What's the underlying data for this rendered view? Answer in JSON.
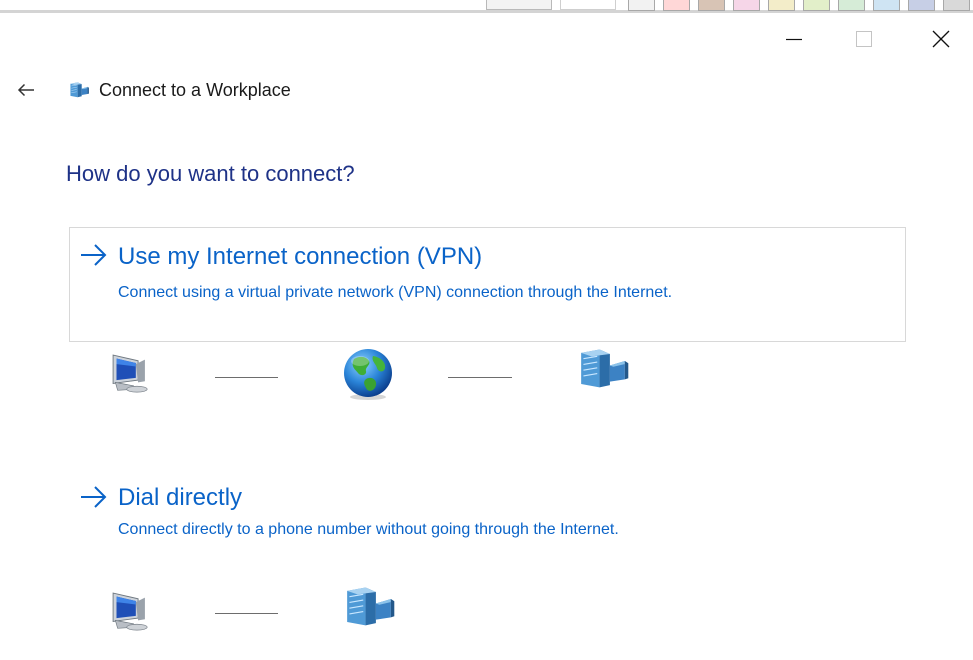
{
  "window": {
    "title": "Connect to a Workplace",
    "icons": {
      "back": "back-arrow-icon",
      "app": "workplace-network-icon",
      "minimize": "minimize-icon",
      "maximize": "maximize-icon",
      "close": "close-icon"
    }
  },
  "main": {
    "heading": "How do you want to connect?",
    "options": [
      {
        "title": "Use my Internet connection (VPN)",
        "description": "Connect using a virtual private network (VPN) connection through the Internet.",
        "diagram": [
          "computer-icon",
          "globe-icon",
          "office-building-icon"
        ]
      },
      {
        "title": "Dial directly",
        "description": "Connect directly to a phone number without going through the Internet.",
        "diagram": [
          "computer-icon",
          "office-building-icon"
        ]
      }
    ]
  },
  "colors": {
    "heading": "#1e3287",
    "link": "#0a63c8",
    "option_border": "#d8d8d8",
    "text": "#1a1a1a"
  }
}
